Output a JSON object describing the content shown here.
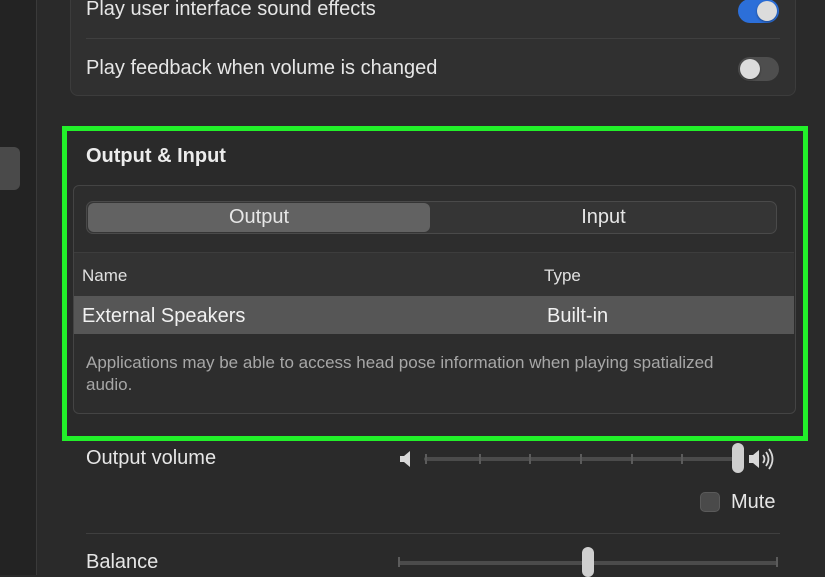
{
  "sound_effects": {
    "play_ui_sounds_label": "Play user interface sound effects",
    "play_feedback_label": "Play feedback when volume is changed",
    "play_ui_sounds_on": true,
    "play_feedback_on": false
  },
  "output_input": {
    "title": "Output & Input",
    "tabs": [
      {
        "label": "Output",
        "selected": true
      },
      {
        "label": "Input",
        "selected": false
      }
    ],
    "columns": [
      "Name",
      "Type"
    ],
    "rows": [
      {
        "name": "External Speakers",
        "type": "Built-in",
        "selected": true
      }
    ],
    "note": "Applications may be able to access head pose information when playing spatialized audio."
  },
  "output_volume": {
    "label": "Output volume",
    "level": 1.0,
    "mute_label": "Mute",
    "muted": false,
    "low_icon": "speaker-low-icon",
    "high_icon": "speaker-high-icon"
  },
  "balance": {
    "label": "Balance",
    "level": 0.5
  },
  "colors": {
    "highlight": "#22f02a",
    "toggle_on": "#2c6fd9"
  }
}
